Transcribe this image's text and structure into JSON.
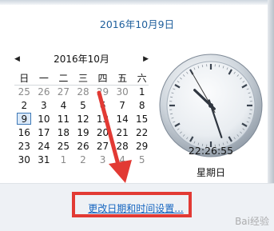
{
  "header": {
    "full_date": "2016年10月9日"
  },
  "calendar": {
    "month_title": "2016年10月",
    "prev_icon": "triangle-left",
    "next_icon": "triangle-right",
    "weekdays": [
      "日",
      "一",
      "二",
      "三",
      "四",
      "五",
      "六"
    ],
    "weeks": [
      [
        "25",
        "26",
        "27",
        "28",
        "29",
        "30",
        "1"
      ],
      [
        "2",
        "3",
        "4",
        "5",
        "6",
        "7",
        "8"
      ],
      [
        "9",
        "10",
        "11",
        "12",
        "13",
        "14",
        "15"
      ],
      [
        "16",
        "17",
        "18",
        "19",
        "20",
        "21",
        "22"
      ],
      [
        "23",
        "24",
        "25",
        "26",
        "27",
        "28",
        "29"
      ],
      [
        "30",
        "31",
        "1",
        "2",
        "3",
        "4",
        "5"
      ]
    ],
    "today": "9"
  },
  "clock": {
    "time": "22:26:55",
    "weekday": "星期日",
    "hours": 22,
    "minutes": 26,
    "seconds": 55
  },
  "footer": {
    "settings_link": "更改日期和时间设置..."
  },
  "annotation": {
    "color": "#e23a34"
  },
  "watermark": "Bai经验"
}
